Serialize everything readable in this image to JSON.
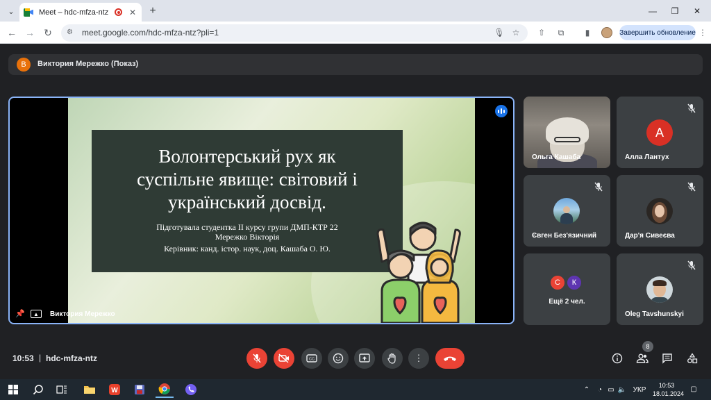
{
  "browser": {
    "tab": {
      "title": "Meet – hdc-mfza-ntz",
      "close_glyph": "✕"
    },
    "new_tab_glyph": "+",
    "window_controls": [
      "—",
      "❐",
      "✕"
    ],
    "url": "meet.google.com/hdc-mfza-ntz?pli=1",
    "update_button": "Завершить обновление"
  },
  "meet": {
    "presenting_banner": {
      "avatar_letter": "В",
      "text": "Виктория Мережко (Показ)",
      "avatar_color": "#e8710a"
    },
    "slide": {
      "title_lines": [
        "Волонтерський рух як",
        "суспільне явище: світовий і",
        "український досвід."
      ],
      "subtitle_1": "Підготувала студентка ІІ курсу групи ДМП-КТР 22",
      "subtitle_2": "Мережко Вікторія",
      "supervisor": "Керівник: канд. істор. наук, доц. Кашаба О. Ю."
    },
    "presenter_name": "Виктория Мережко",
    "participants": [
      {
        "name": "Ольга Кашаба",
        "type": "camera"
      },
      {
        "name": "Алла Лантух",
        "avatar_letter": "А",
        "avatar_color": "#d93025",
        "muted": true
      },
      {
        "name": "Євген Без'язичний",
        "type": "photo",
        "muted": true
      },
      {
        "name": "Дар'я Сивеєва",
        "type": "photo",
        "muted": true
      },
      {
        "others_label": "Ещё 2 чел.",
        "letters": [
          "С",
          "К"
        ],
        "colors": [
          "#ea4335",
          "#5e35b1"
        ],
        "muted": true
      },
      {
        "name": "Oleg Tavshunskyi",
        "type": "photo",
        "muted": true
      }
    ],
    "bottom": {
      "time": "10:53",
      "separator": "|",
      "meeting_code": "hdc-mfza-ntz",
      "people_count": "8"
    }
  },
  "taskbar": {
    "language": "УКР",
    "time": "10:53",
    "date": "18.01.2024"
  },
  "colors": {
    "accent": "#8ab4f8",
    "end_call": "#ea4335",
    "meet_bg": "#202124"
  }
}
